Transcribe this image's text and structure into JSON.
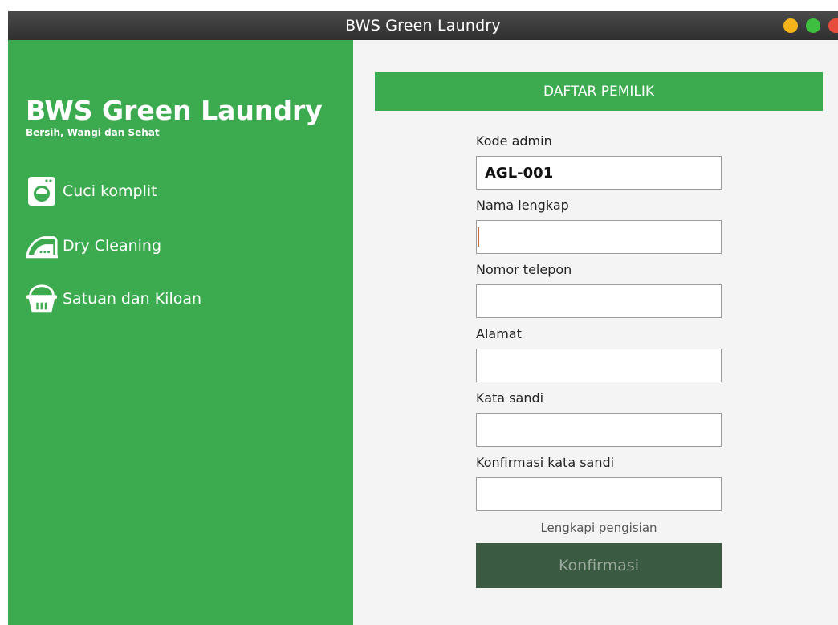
{
  "window": {
    "title": "BWS Green  Laundry",
    "controls": [
      "minimize",
      "maximize",
      "close"
    ]
  },
  "sidebar": {
    "brand": "BWS Green Laundry",
    "tagline": "Bersih, Wangi dan Sehat",
    "items": [
      {
        "label": "Cuci komplit",
        "icon": "washing-machine-icon"
      },
      {
        "label": "Dry Cleaning",
        "icon": "iron-icon"
      },
      {
        "label": "Satuan dan Kiloan",
        "icon": "laundry-basket-icon"
      }
    ]
  },
  "form": {
    "header": "DAFTAR PEMILIK",
    "fields": [
      {
        "label": "Kode admin",
        "value": "AGL-001"
      },
      {
        "label": "Nama lengkap",
        "value": ""
      },
      {
        "label": "Nomor telepon",
        "value": ""
      },
      {
        "label": "Alamat",
        "value": ""
      },
      {
        "label": "Kata sandi",
        "value": ""
      },
      {
        "label": "Konfirmasi kata sandi",
        "value": ""
      }
    ],
    "hint": "Lengkapi pengisian",
    "submit_label": "Konfirmasi"
  },
  "colors": {
    "primary_green": "#3cab50",
    "button_dark_green": "#3a5a42",
    "titlebar": "#3a3a3a"
  }
}
